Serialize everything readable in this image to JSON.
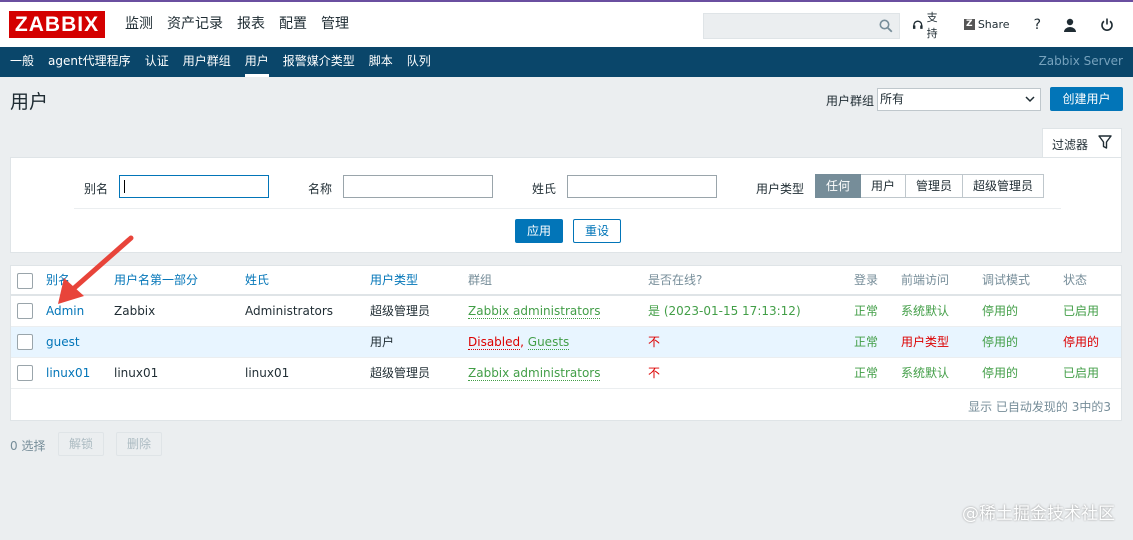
{
  "header": {
    "logo": "ZABBIX",
    "menu": [
      "监测",
      "资产记录",
      "报表",
      "配置",
      "管理"
    ],
    "active_menu": "管理",
    "search_placeholder": "",
    "support_label": "支持",
    "share_label": "Share",
    "help_icon": "question-icon",
    "user_icon": "user-icon",
    "logout_icon": "power-icon"
  },
  "submenu": {
    "items": [
      "一般",
      "agent代理程序",
      "认证",
      "用户群组",
      "用户",
      "报警媒介类型",
      "脚本",
      "队列"
    ],
    "active": "用户",
    "server_name": "Zabbix Server"
  },
  "page": {
    "title": "用户",
    "group_label": "用户群组",
    "group_value": "所有",
    "create_button": "创建用户"
  },
  "filter": {
    "tab_label": "过滤器",
    "alias_label": "别名",
    "name_label": "名称",
    "surname_label": "姓氏",
    "type_label": "用户类型",
    "type_options": [
      "任何",
      "用户",
      "管理员",
      "超级管理员"
    ],
    "type_selected": "任何",
    "apply_button": "应用",
    "reset_button": "重设"
  },
  "table": {
    "columns": [
      "别名",
      "用户名第一部分",
      "姓氏",
      "用户类型",
      "群组",
      "是否在线?",
      "登录",
      "前端访问",
      "调试模式",
      "状态"
    ],
    "rows": [
      {
        "alias": "Admin",
        "name": "Zabbix",
        "surname": "Administrators",
        "type": "超级管理员",
        "groups": [
          {
            "text": "Zabbix administrators",
            "color": "green"
          }
        ],
        "online": "是 (2023-01-15 17:13:12)",
        "online_color": "green",
        "login": "正常",
        "frontend": "系统默认",
        "frontend_color": "green",
        "debug": "停用的",
        "status": "已启用",
        "status_color": "green"
      },
      {
        "alias": "guest",
        "name": "",
        "surname": "",
        "type": "用户",
        "groups": [
          {
            "text": "Disabled",
            "color": "red"
          },
          {
            "text": "Guests",
            "color": "green"
          }
        ],
        "online": "不",
        "online_color": "red",
        "login": "正常",
        "frontend": "用户类型",
        "frontend_color": "red",
        "debug": "停用的",
        "status": "停用的",
        "status_color": "red"
      },
      {
        "alias": "linux01",
        "name": "linux01",
        "surname": "linux01",
        "type": "超级管理员",
        "groups": [
          {
            "text": "Zabbix administrators",
            "color": "green"
          }
        ],
        "online": "不",
        "online_color": "red",
        "login": "正常",
        "frontend": "系统默认",
        "frontend_color": "green",
        "debug": "停用的",
        "status": "已启用",
        "status_color": "green"
      }
    ],
    "footer": "显示 已自动发现的 3中的3"
  },
  "actions": {
    "selected": "0 选择",
    "unlock_button": "解锁",
    "delete_button": "删除"
  },
  "watermark": "@稀土掘金技术社区",
  "colors": {
    "brand_red": "#d40000",
    "nav_blue": "#0a466a",
    "link_blue": "#0275b8",
    "ok_green": "#429e47",
    "bad_red": "#dc0000",
    "annotation_red": "#e8443a"
  }
}
